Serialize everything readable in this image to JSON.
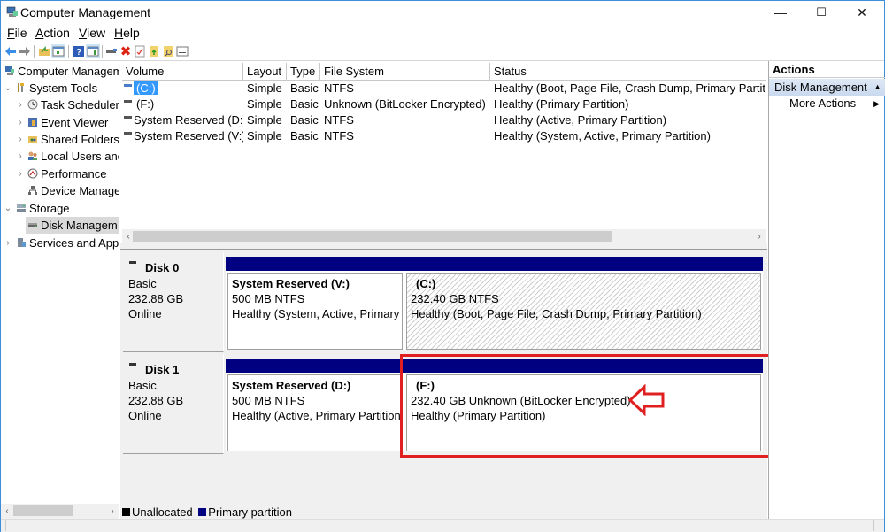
{
  "window": {
    "title": "Computer Management",
    "controls": {
      "minimize": "—",
      "maximize": "☐",
      "close": "✕"
    }
  },
  "menu": [
    {
      "label": "File",
      "accel": "F",
      "rest": "ile"
    },
    {
      "label": "Action",
      "accel": "A",
      "rest": "ction"
    },
    {
      "label": "View",
      "accel": "V",
      "rest": "iew"
    },
    {
      "label": "Help",
      "accel": "H",
      "rest": "elp"
    }
  ],
  "toolbar": {
    "icons": [
      "back-icon",
      "forward-icon",
      "up-folder-icon",
      "show-hide-tree-icon",
      "help-icon",
      "show-hide-action-pane-icon",
      "connect-drive-icon",
      "delete-icon",
      "check-icon",
      "folder-up-icon",
      "folder-search-icon",
      "properties-icon"
    ]
  },
  "tree": {
    "items": [
      {
        "label": "Computer Management (Local)",
        "display": "Computer Managem",
        "level": 0,
        "expander": "",
        "icon": "computer-management-icon"
      },
      {
        "label": "System Tools",
        "display": "System Tools",
        "level": 1,
        "expander": "⌄",
        "icon": "system-tools-icon"
      },
      {
        "label": "Task Scheduler",
        "display": "Task Scheduler",
        "level": 2,
        "expander": "›",
        "icon": "clock-icon"
      },
      {
        "label": "Event Viewer",
        "display": "Event Viewer",
        "level": 2,
        "expander": "›",
        "icon": "event-viewer-icon"
      },
      {
        "label": "Shared Folders",
        "display": "Shared Folders",
        "level": 2,
        "expander": "›",
        "icon": "shared-folders-icon"
      },
      {
        "label": "Local Users and Groups",
        "display": "Local Users and",
        "level": 2,
        "expander": "›",
        "icon": "users-icon"
      },
      {
        "label": "Performance",
        "display": "Performance",
        "level": 2,
        "expander": "›",
        "icon": "performance-icon"
      },
      {
        "label": "Device Manager",
        "display": "Device Manager",
        "level": 2,
        "expander": "",
        "icon": "device-manager-icon"
      },
      {
        "label": "Storage",
        "display": "Storage",
        "level": 1,
        "expander": "⌄",
        "icon": "storage-icon"
      },
      {
        "label": "Disk Management",
        "display": "Disk Managem",
        "level": 2,
        "expander": "",
        "icon": "disk-icon",
        "selected": true
      },
      {
        "label": "Services and Applications",
        "display": "Services and App",
        "level": 1,
        "expander": "›",
        "icon": "services-icon"
      }
    ]
  },
  "volume_list": {
    "columns": [
      "Volume",
      "Layout",
      "Type",
      "File System",
      "Status"
    ],
    "rows": [
      {
        "volume": "(C:)",
        "layout": "Simple",
        "type": "Basic",
        "fs": "NTFS",
        "status": "Healthy (Boot, Page File, Crash Dump, Primary Partition)",
        "selected": true
      },
      {
        "volume": "(F:)",
        "layout": "Simple",
        "type": "Basic",
        "fs": "Unknown (BitLocker Encrypted)",
        "status": "Healthy (Primary Partition)"
      },
      {
        "volume": "System Reserved (D:)",
        "layout": "Simple",
        "type": "Basic",
        "fs": "NTFS",
        "status": "Healthy (Active, Primary Partition)"
      },
      {
        "volume": "System Reserved (V:)",
        "layout": "Simple",
        "type": "Basic",
        "fs": "NTFS",
        "status": "Healthy (System, Active, Primary Partition)"
      }
    ]
  },
  "disks": [
    {
      "name": "Disk 0",
      "type": "Basic",
      "size": "232.88 GB",
      "state": "Online",
      "partitions": [
        {
          "title": "System Reserved  (V:)",
          "size": "500 MB NTFS",
          "status": "Healthy (System, Active, Primary Partition)",
          "hatched": false
        },
        {
          "title": "(C:)",
          "size": "232.40 GB NTFS",
          "status": "Healthy (Boot, Page File, Crash Dump, Primary Partition)",
          "hatched": true
        }
      ]
    },
    {
      "name": "Disk 1",
      "type": "Basic",
      "size": "232.88 GB",
      "state": "Online",
      "partitions": [
        {
          "title": "System Reserved  (D:)",
          "size": "500 MB NTFS",
          "status": "Healthy (Active, Primary Partition)",
          "hatched": false
        },
        {
          "title": "(F:)",
          "size": "232.40 GB Unknown (BitLocker Encrypted)",
          "status": "Healthy (Primary Partition)",
          "hatched": false
        }
      ]
    }
  ],
  "legend": [
    {
      "label": "Unallocated",
      "color": "#000000"
    },
    {
      "label": "Primary partition",
      "color": "#000080"
    }
  ],
  "actions": {
    "header": "Actions",
    "section": "Disk Management",
    "items": [
      "More Actions"
    ]
  },
  "annotation": {
    "color": "#e02020",
    "target": "(F:) partition"
  },
  "colors": {
    "accent": "#3399ff",
    "partition_bar": "#000080",
    "window_border": "#3c8fd6"
  }
}
